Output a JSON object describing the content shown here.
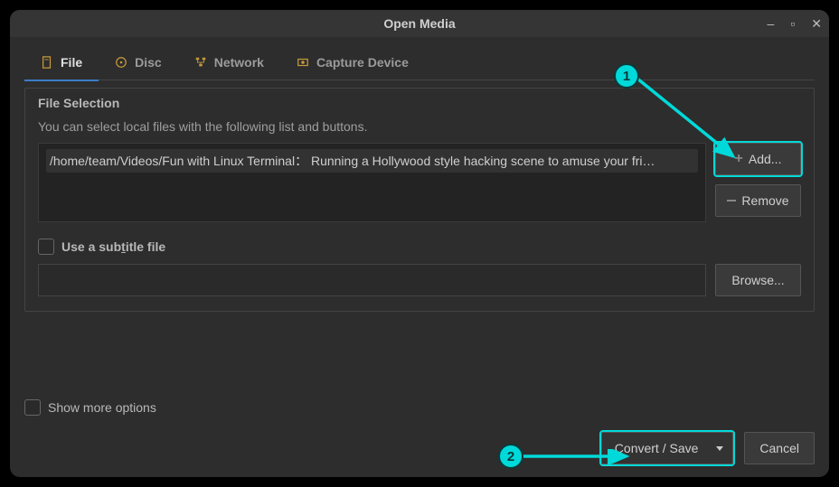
{
  "window": {
    "title": "Open Media"
  },
  "tabs": {
    "file": "File",
    "disc": "Disc",
    "network": "Network",
    "capture": "Capture Device"
  },
  "fileSelection": {
    "groupTitle": "File Selection",
    "hint": "You can select local files with the following list and buttons.",
    "entry": "/home/team/Videos/Fun with Linux Terminal： Running a Hollywood style hacking scene to amuse your fri…",
    "addLabel": "Add...",
    "removeLabel": "Remove",
    "subtitleCheck": "Use a subtitle file",
    "browseLabel": "Browse..."
  },
  "footer": {
    "moreOptions": "Show more options",
    "convertSave": "Convert / Save",
    "cancel": "Cancel"
  },
  "annotations": {
    "badge1": "1",
    "badge2": "2"
  }
}
